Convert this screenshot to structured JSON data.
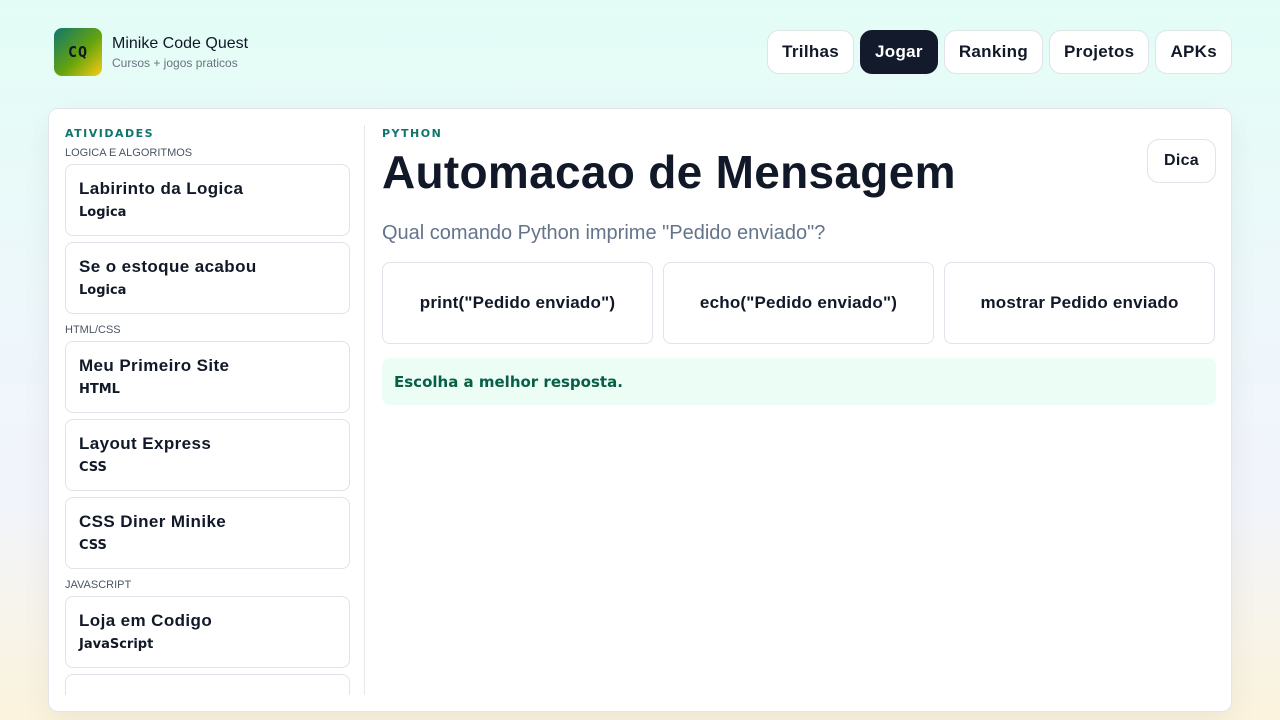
{
  "brand": {
    "logo_text": "CQ",
    "name": "Minike Code Quest",
    "subtitle": "Cursos + jogos praticos"
  },
  "nav": {
    "items": [
      {
        "label": "Trilhas",
        "active": false
      },
      {
        "label": "Jogar",
        "active": true
      },
      {
        "label": "Ranking",
        "active": false
      },
      {
        "label": "Projetos",
        "active": false
      },
      {
        "label": "APKs",
        "active": false
      }
    ]
  },
  "sidebar": {
    "title": "ATIVIDADES",
    "groups": [
      {
        "label": "LOGICA E ALGORITMOS",
        "items": [
          {
            "title": "Labirinto da Logica",
            "tag": "Logica"
          },
          {
            "title": "Se o estoque acabou",
            "tag": "Logica"
          }
        ]
      },
      {
        "label": "HTML/CSS",
        "items": [
          {
            "title": "Meu Primeiro Site",
            "tag": "HTML"
          },
          {
            "title": "Layout Express",
            "tag": "CSS"
          },
          {
            "title": "CSS Diner Minike",
            "tag": "CSS"
          }
        ]
      },
      {
        "label": "JAVASCRIPT",
        "items": [
          {
            "title": "Loja em Codigo",
            "tag": "JavaScript"
          }
        ]
      }
    ]
  },
  "main": {
    "language": "PYTHON",
    "title": "Automacao de Mensagem",
    "hint_label": "Dica",
    "question": "Qual comando Python imprime \"Pedido enviado\"?",
    "options": [
      "print(\"Pedido enviado\")",
      "echo(\"Pedido enviado\")",
      "mostrar Pedido enviado"
    ],
    "feedback": "Escolha a melhor resposta."
  },
  "colors": {
    "accent": "#0f766e",
    "active_nav": "#121a2b",
    "feedback_bg": "#ecfdf5",
    "feedback_text": "#065f46"
  }
}
